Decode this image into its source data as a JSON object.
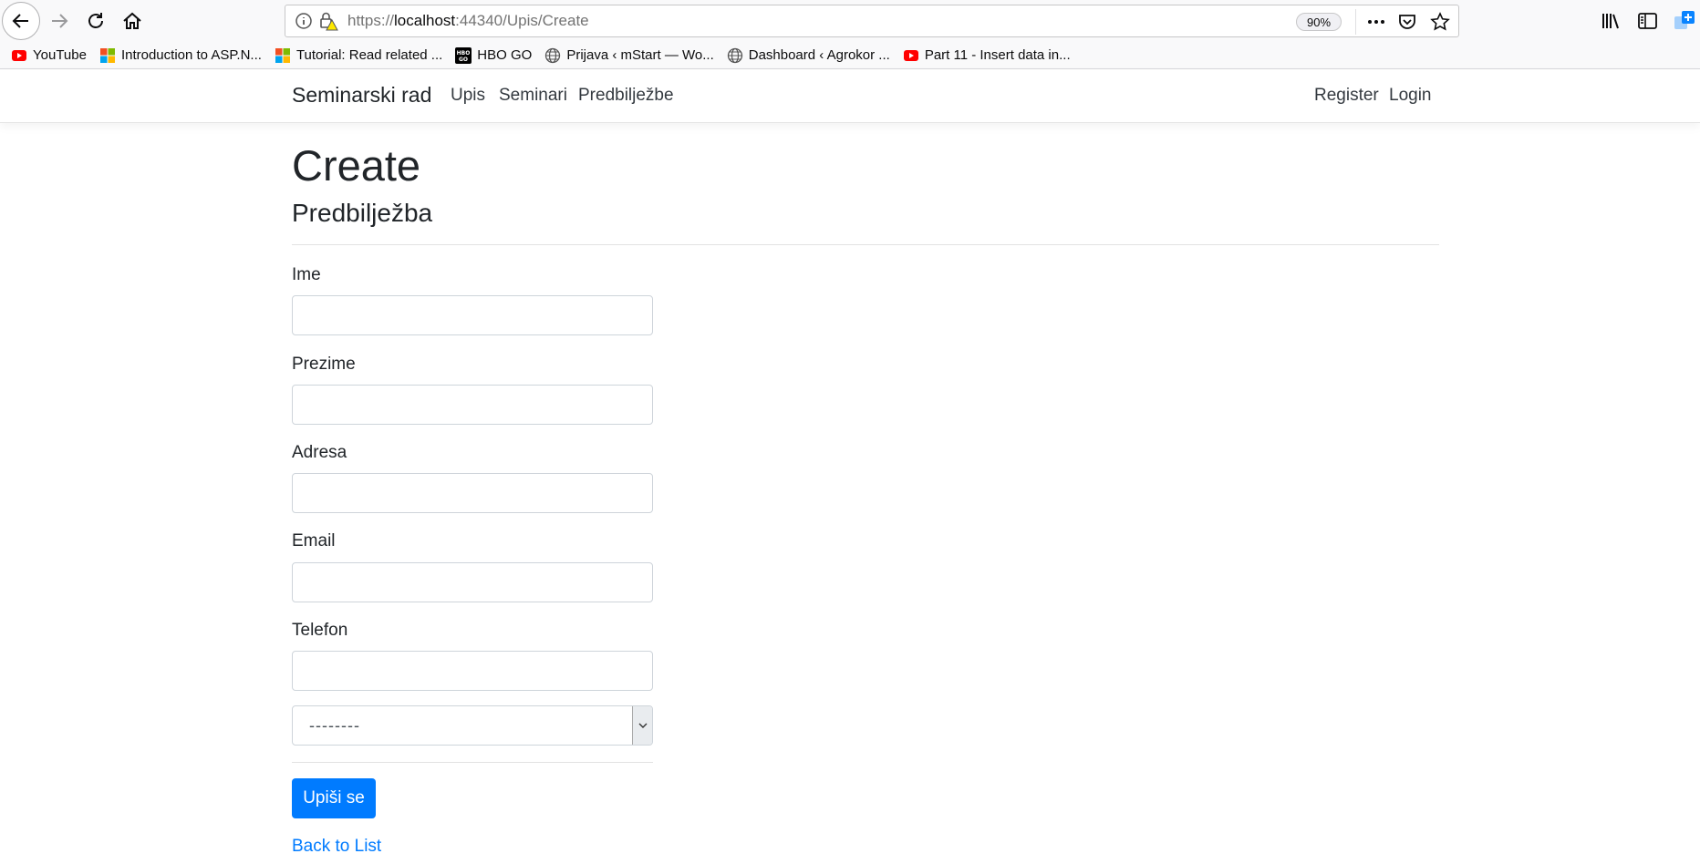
{
  "browser": {
    "url_prefix": "https://",
    "url_host": "localhost",
    "url_rest": ":44340/Upis/Create",
    "zoom": "90%"
  },
  "bookmarks": [
    {
      "label": "YouTube",
      "icon": "youtube-icon"
    },
    {
      "label": "Introduction to ASP.N...",
      "icon": "microsoft-icon"
    },
    {
      "label": "Tutorial: Read related ...",
      "icon": "microsoft-icon"
    },
    {
      "label": "HBO GO",
      "icon": "hbo-icon"
    },
    {
      "label": "Prijava ‹ mStart — Wo...",
      "icon": "globe-icon"
    },
    {
      "label": "Dashboard ‹ Agrokor ...",
      "icon": "globe-icon"
    },
    {
      "label": "Part 11 - Insert data in...",
      "icon": "youtube-icon"
    }
  ],
  "navbar": {
    "brand": "Seminarski rad",
    "links": [
      "Upis",
      "Seminari",
      "Predbilježbe"
    ],
    "register": "Register",
    "login": "Login"
  },
  "page": {
    "title": "Create",
    "subtitle": "Predbilježba"
  },
  "form": {
    "fields": [
      {
        "label": "Ime",
        "value": ""
      },
      {
        "label": "Prezime",
        "value": ""
      },
      {
        "label": "Adresa",
        "value": ""
      },
      {
        "label": "Email",
        "value": ""
      },
      {
        "label": "Telefon",
        "value": ""
      }
    ],
    "select_value": "--------",
    "submit_label": "Upiši se",
    "back_link": "Back to List"
  },
  "colors": {
    "primary": "#007bff",
    "youtube": "#ff0000"
  }
}
